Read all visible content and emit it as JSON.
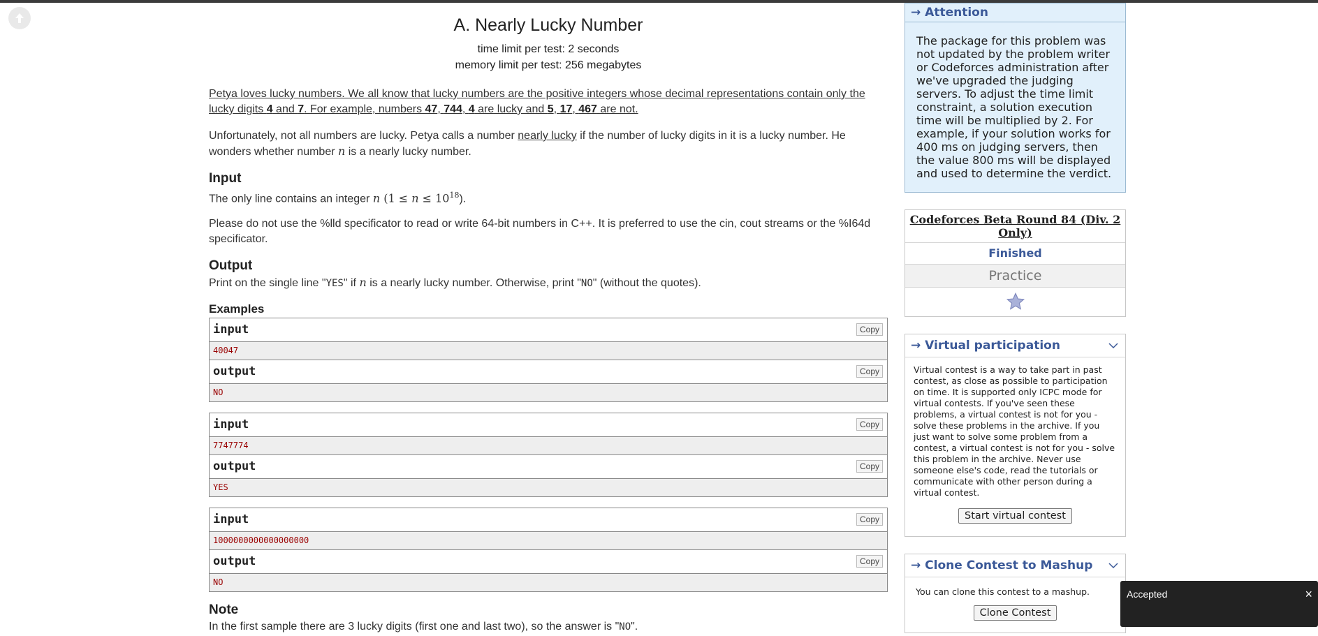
{
  "problem": {
    "title": "A. Nearly Lucky Number",
    "time_limit": "time limit per test: 2 seconds",
    "memory_limit": "memory limit per test: 256 megabytes",
    "p1": {
      "t1": "Petya loves lucky numbers. We all know that lucky numbers are the positive integers whose decimal representations contain only the lucky digits ",
      "b1": "4",
      "t2": " and ",
      "b2": "7",
      "t3": ". For example, numbers ",
      "b3": "47",
      "t4": ", ",
      "b4": "744",
      "t5": ", ",
      "b5": "4",
      "t6": " are lucky and ",
      "b6": "5",
      "t7": ", ",
      "b7": "17",
      "t8": ", ",
      "b8": "467",
      "t9": " are not."
    },
    "p2": {
      "t1": "Unfortunately, not all numbers are lucky. Petya calls a number ",
      "link": "nearly lucky",
      "t2": " if the number of lucky digits in it is a lucky number. He wonders whether number ",
      "var": "n",
      "t3": " is a nearly lucky number."
    },
    "input": {
      "title": "Input",
      "t1": "The only line contains an integer ",
      "var": "n",
      "constraint_open": " (1 ≤ ",
      "constraint_var": "n",
      "constraint_mid": " ≤ 10",
      "constraint_exp": "18",
      "constraint_close": ").",
      "note": "Please do not use the %lld specificator to read or write 64-bit numbers in С++. It is preferred to use the cin, cout streams or the %I64d specificator."
    },
    "output": {
      "title": "Output",
      "t1": "Print on the single line \"",
      "yes": "YES",
      "t2": "\" if ",
      "var": "n",
      "t3": " is a nearly lucky number. Otherwise, print \"",
      "no": "NO",
      "t4": "\" (without the quotes)."
    },
    "examples_title": "Examples",
    "samples": [
      {
        "input_label": "input",
        "input_value": "40047",
        "output_label": "output",
        "output_value": "NO"
      },
      {
        "input_label": "input",
        "input_value": "7747774",
        "output_label": "output",
        "output_value": "YES"
      },
      {
        "input_label": "input",
        "input_value": "1000000000000000000",
        "output_label": "output",
        "output_value": "NO"
      }
    ],
    "copy_label": "Copy",
    "note": {
      "title": "Note",
      "t1": "In the first sample there are 3 lucky digits (first one and last two), so the answer is \"",
      "no": "NO",
      "t2": "\"."
    }
  },
  "sidebar": {
    "attention": {
      "title": "→ Attention",
      "text": "The package for this problem was not updated by the problem writer or Codeforces administration after we've upgraded the judging servers. To adjust the time limit constraint, a solution execution time will be multiplied by 2. For example, if your solution works for 400 ms on judging servers, then the value 800 ms will be displayed and used to determine the verdict."
    },
    "contest": {
      "name": "Codeforces Beta Round 84 (Div. 2 Only)",
      "phase": "Finished",
      "practice": "Practice"
    },
    "virtual": {
      "title": "→ Virtual participation",
      "text": "Virtual contest is a way to take part in past contest, as close as possible to participation on time. It is supported only ICPC mode for virtual contests. If you've seen these problems, a virtual contest is not for you - solve these problems in the archive. If you just want to solve some problem from a contest, a virtual contest is not for you - solve this problem in the archive. Never use someone else's code, read the tutorials or communicate with other person during a virtual contest.",
      "button": "Start virtual contest"
    },
    "clone": {
      "title": "→ Clone Contest to Mashup",
      "text": "You can clone this contest to a mashup.",
      "button": "Clone Contest"
    }
  },
  "toast": {
    "text": "Accepted",
    "close": "×"
  },
  "colors": {
    "link_blue": "#3b5998",
    "attention_bg": "#e1f0fb",
    "sample_text": "#990000",
    "toast_bg": "#222222"
  },
  "icons": [
    "back-arrow-icon",
    "star-icon",
    "chevron-down-icon",
    "close-icon"
  ]
}
